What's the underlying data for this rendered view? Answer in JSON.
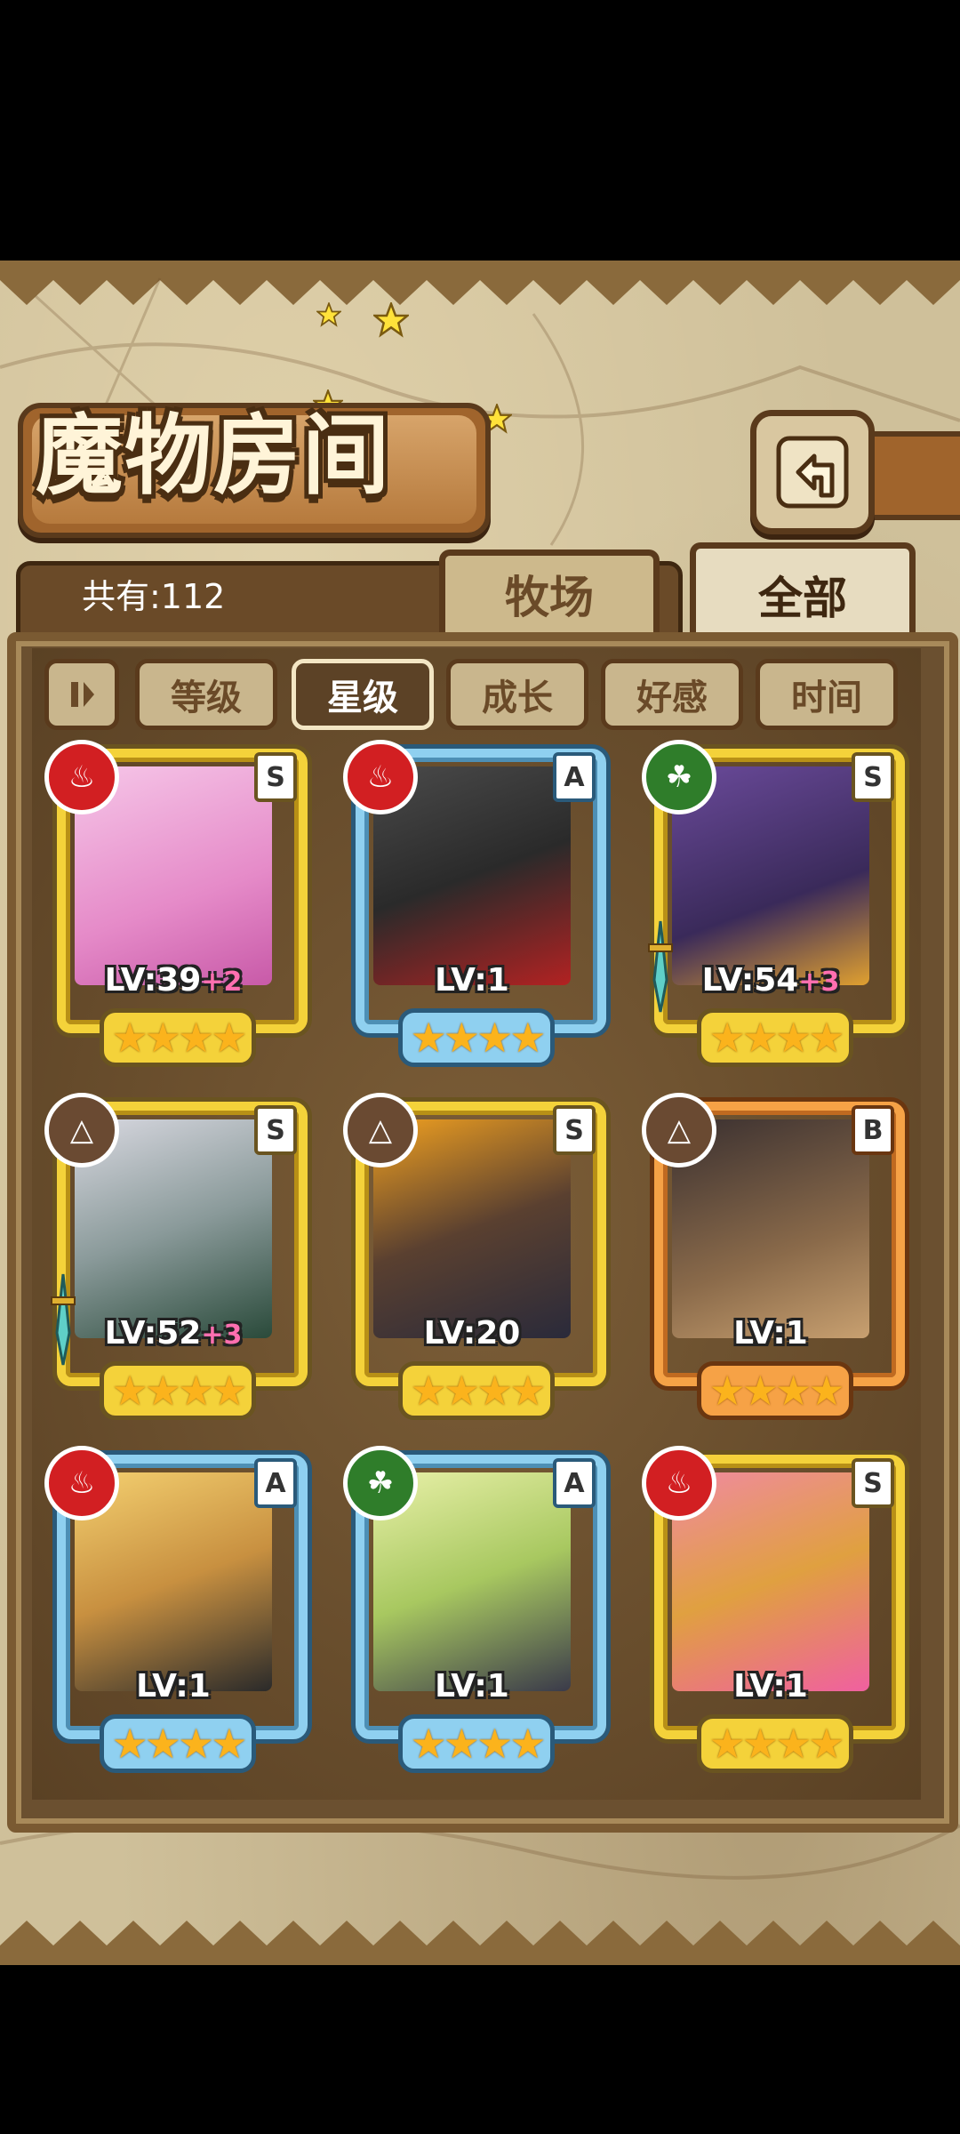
{
  "header": {
    "title": "魔物房间",
    "back_icon": "back-arrow-icon",
    "count_label": "共有:112"
  },
  "tabs": [
    {
      "label": "牧场",
      "active": false
    },
    {
      "label": "全部",
      "active": true
    }
  ],
  "sort": {
    "toggle_icon": "pause-icon",
    "buttons": [
      {
        "label": "等级",
        "active": false
      },
      {
        "label": "星级",
        "active": true
      },
      {
        "label": "成长",
        "active": false
      },
      {
        "label": "好感",
        "active": false
      },
      {
        "label": "时间",
        "active": false
      }
    ]
  },
  "monsters": [
    {
      "level": "LV:39",
      "bonus": "+2",
      "rank": "S",
      "element": "fire",
      "frame": "gold",
      "stars": "★★★★"
    },
    {
      "level": "LV:1",
      "bonus": "",
      "rank": "A",
      "element": "fire",
      "frame": "blue",
      "stars": "★★★★"
    },
    {
      "level": "LV:54",
      "bonus": "+3",
      "rank": "S",
      "element": "leaf",
      "frame": "gold",
      "stars": "★★★★"
    },
    {
      "level": "LV:52",
      "bonus": "+3",
      "rank": "S",
      "element": "earth",
      "frame": "gold",
      "stars": "★★★★"
    },
    {
      "level": "LV:20",
      "bonus": "",
      "rank": "S",
      "element": "earth",
      "frame": "gold",
      "stars": "★★★★"
    },
    {
      "level": "LV:1",
      "bonus": "",
      "rank": "B",
      "element": "earth",
      "frame": "orange",
      "stars": "★★★★"
    },
    {
      "level": "LV:1",
      "bonus": "",
      "rank": "A",
      "element": "fire",
      "frame": "blue",
      "stars": "★★★★"
    },
    {
      "level": "LV:1",
      "bonus": "",
      "rank": "A",
      "element": "leaf",
      "frame": "blue",
      "stars": "★★★★"
    },
    {
      "level": "LV:1",
      "bonus": "",
      "rank": "S",
      "element": "fire",
      "frame": "gold",
      "stars": "★★★★"
    }
  ],
  "colors": {
    "parchment": "#cfc09a",
    "wood": "#5a3a1c",
    "gold_frame": "#f4d23a",
    "blue_frame": "#8fd0f0",
    "orange_frame": "#f6a246",
    "fire": "#d21f22",
    "leaf": "#2f7d2a",
    "earth": "#6a4a32"
  }
}
